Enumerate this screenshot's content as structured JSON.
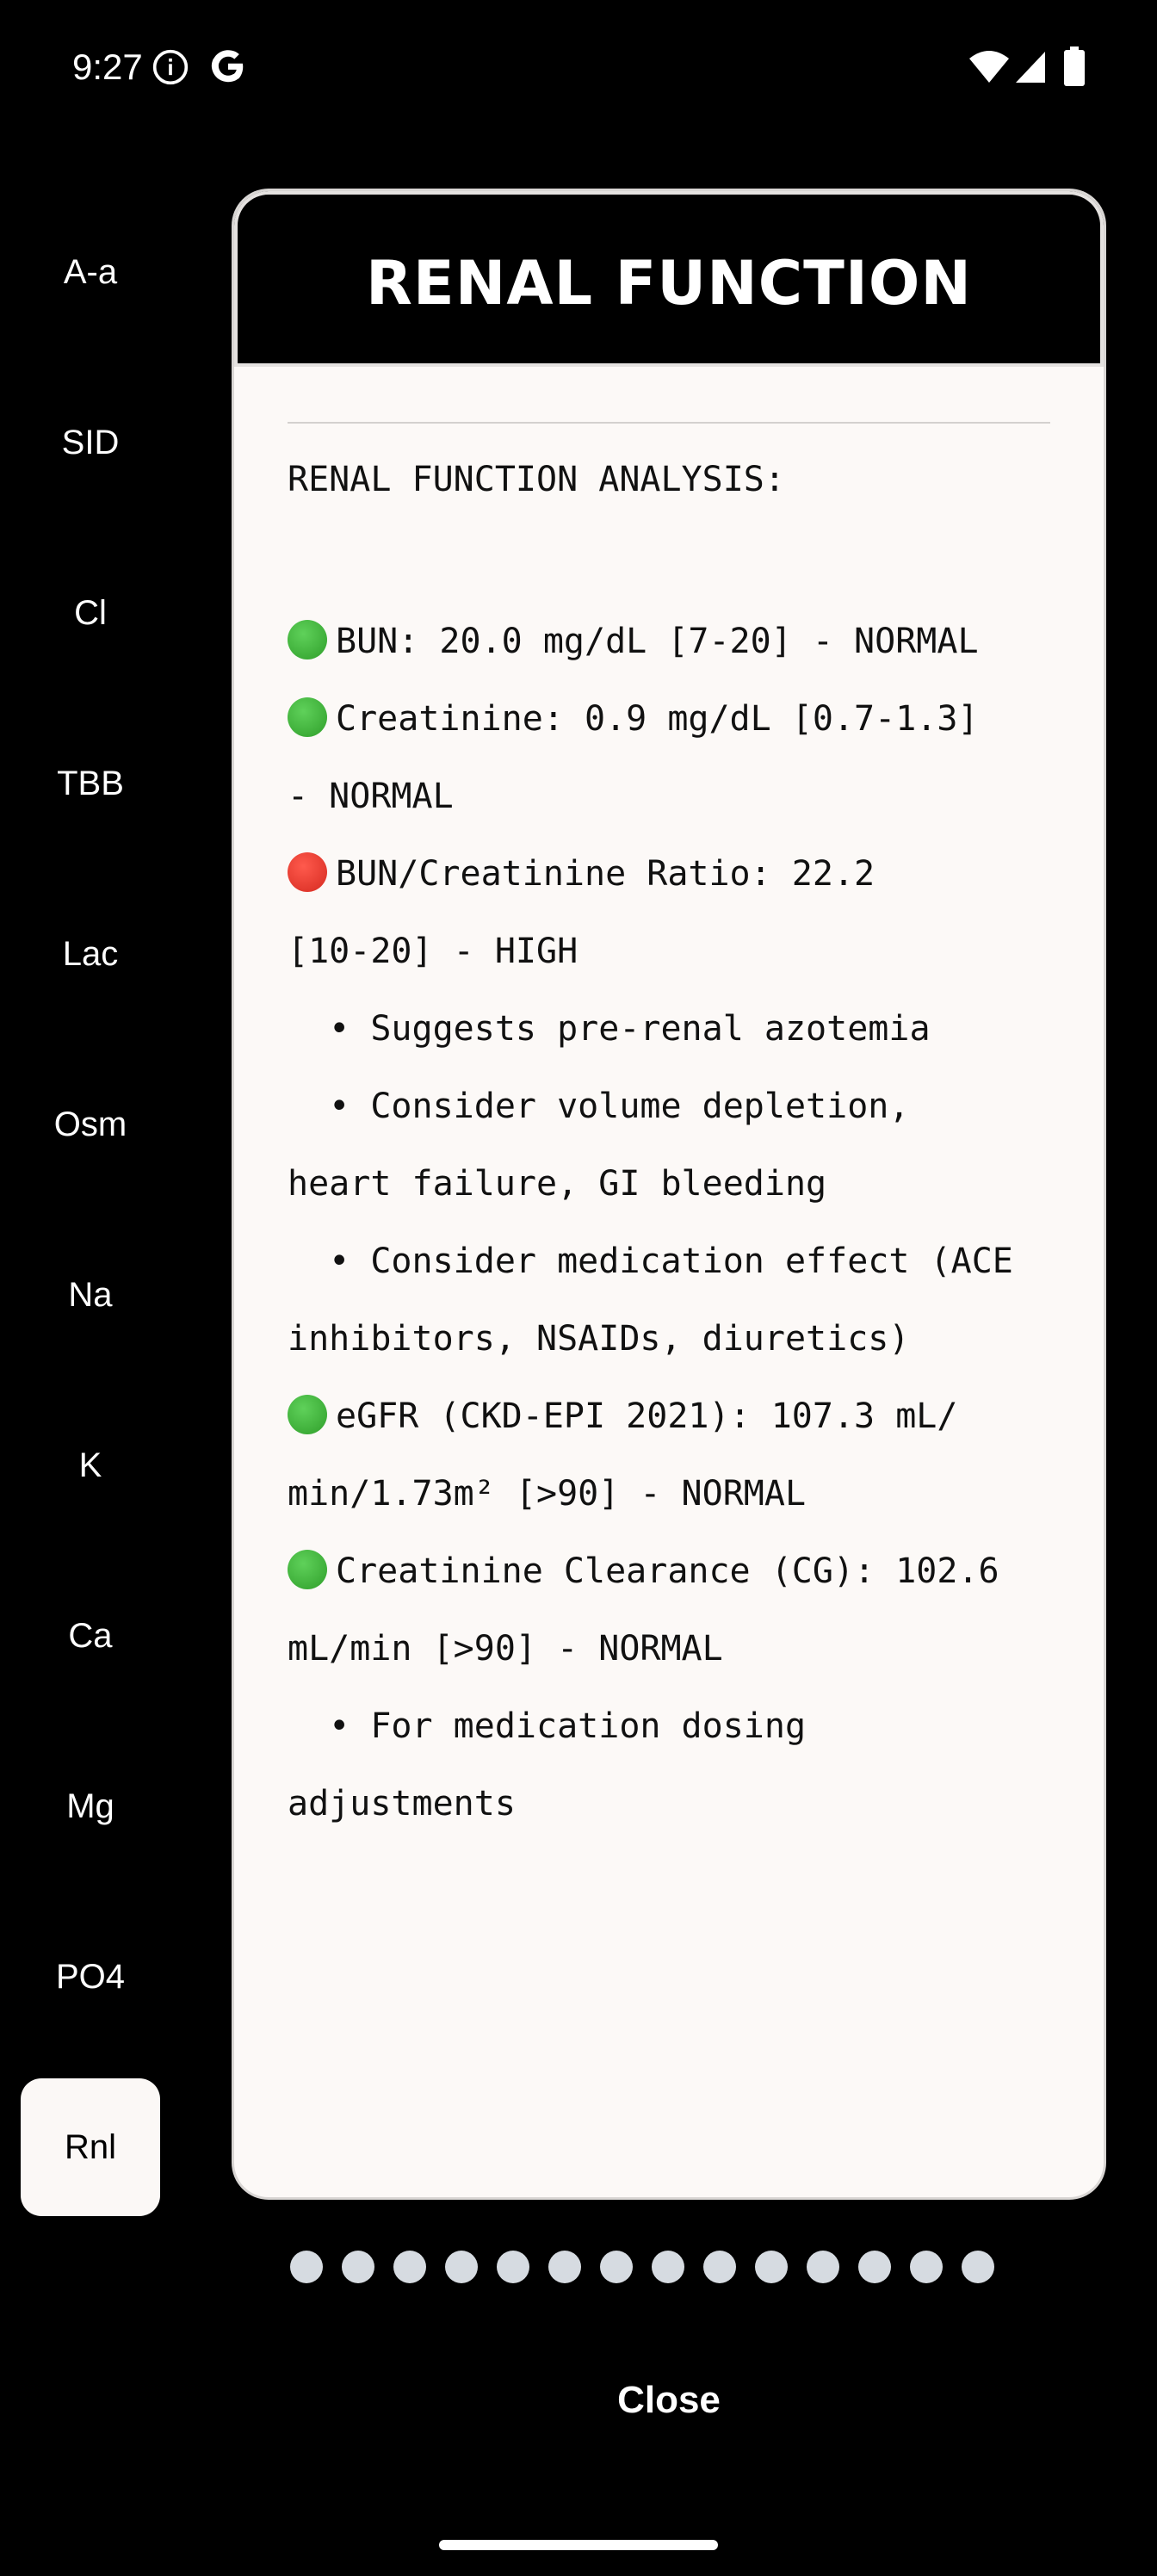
{
  "status_bar": {
    "time": "9:27",
    "icons": [
      "info-icon",
      "google-g-icon",
      "wifi-icon",
      "cell-signal-icon",
      "battery-icon"
    ]
  },
  "sidebar": {
    "items": [
      {
        "label": "A-a",
        "active": false
      },
      {
        "label": "SID",
        "active": false
      },
      {
        "label": "Cl",
        "active": false
      },
      {
        "label": "TBB",
        "active": false
      },
      {
        "label": "Lac",
        "active": false
      },
      {
        "label": "Osm",
        "active": false
      },
      {
        "label": "Na",
        "active": false
      },
      {
        "label": "K",
        "active": false
      },
      {
        "label": "Ca",
        "active": false
      },
      {
        "label": "Mg",
        "active": false
      },
      {
        "label": "PO4",
        "active": false
      },
      {
        "label": "Rnl",
        "active": true
      }
    ]
  },
  "card": {
    "title": "RENAL FUNCTION",
    "heading": "RENAL FUNCTION ANALYSIS:",
    "lines": [
      {
        "status": "green",
        "text": "BUN: 20.0 mg/dL [7-20] - NORMAL"
      },
      {
        "status": "green",
        "text": "Creatinine: 0.9 mg/dL [0.7-1.3]"
      },
      {
        "status": "",
        "text": "- NORMAL"
      },
      {
        "status": "red",
        "text": "BUN/Creatinine Ratio: 22.2"
      },
      {
        "status": "",
        "text": "[10-20] - HIGH"
      },
      {
        "status": "",
        "text": "  • Suggests pre-renal azotemia"
      },
      {
        "status": "",
        "text": "  • Consider volume depletion,"
      },
      {
        "status": "",
        "text": "heart failure, GI bleeding"
      },
      {
        "status": "",
        "text": "  • Consider medication effect (ACE"
      },
      {
        "status": "",
        "text": "inhibitors, NSAIDs, diuretics)"
      },
      {
        "status": "green",
        "text": "eGFR (CKD-EPI 2021): 107.3 mL/"
      },
      {
        "status": "",
        "text": "min/1.73m² [>90] - NORMAL"
      },
      {
        "status": "green",
        "text": "Creatinine Clearance (CG): 102.6"
      },
      {
        "status": "",
        "text": "mL/min [>90] - NORMAL"
      },
      {
        "status": "",
        "text": "  • For medication dosing"
      },
      {
        "status": "",
        "text": "adjustments"
      }
    ]
  },
  "pager": {
    "count": 14,
    "current": 14
  },
  "footer": {
    "close_label": "Close"
  },
  "colors": {
    "background": "#000000",
    "card": "#fcf9f7",
    "status_green": "#3cb534",
    "status_red": "#e53a2e",
    "pager_dot": "#d6dbe1"
  }
}
